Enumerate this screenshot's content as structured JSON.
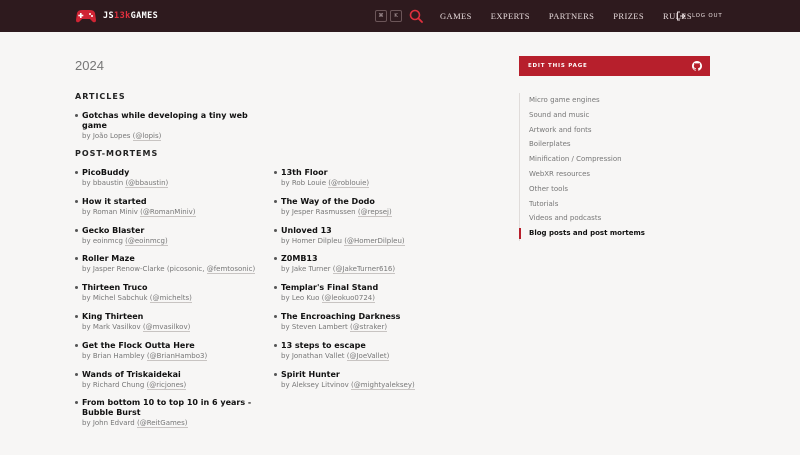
{
  "header": {
    "logo": {
      "part1": "JS",
      "part2": "13k",
      "part3": "GAMES"
    },
    "kbd": [
      "⌘",
      "K"
    ],
    "nav": [
      "Games",
      "Experts",
      "Partners",
      "Prizes",
      "Rules"
    ],
    "logout": "LOG OUT"
  },
  "page": {
    "year": "2024",
    "articles_heading": "ARTICLES",
    "postmortems_heading": "POST-MORTEMS"
  },
  "articles": [
    {
      "title": "Gotchas while developing a tiny web game",
      "author": "João Lopes",
      "handle": "(@lopis)"
    }
  ],
  "postmortems_left": [
    {
      "title": "PicoBuddy",
      "author": "bbaustin",
      "handle": "(@bbaustin)"
    },
    {
      "title": "How it started",
      "author": "Roman Miniv",
      "handle": "(@RomanMiniv)"
    },
    {
      "title": "Gecko Blaster",
      "author": "eoinmcg",
      "handle": "(@eoinmcg)"
    },
    {
      "title": "Roller Maze",
      "author": "Jasper Renow-Clarke (picosonic,",
      "handle": "@femtosonic)"
    },
    {
      "title": "Thirteen Truco",
      "author": "Michel Sabchuk",
      "handle": "(@michelts)"
    },
    {
      "title": "King Thirteen",
      "author": "Mark Vasilkov",
      "handle": "(@mvasilkov)"
    },
    {
      "title": "Get the Flock Outta Here",
      "author": "Brian Hambley",
      "handle": "(@BrianHambo3)"
    },
    {
      "title": "Wands of Triskaidekai",
      "author": "Richard Chung",
      "handle": "(@ricjones)"
    },
    {
      "title": "From bottom 10 to top 10 in 6 years - Bubble Burst",
      "author": "John Edvard",
      "handle": "(@ReitGames)"
    }
  ],
  "postmortems_right": [
    {
      "title": "13th Floor",
      "author": "Rob Louie",
      "handle": "(@roblouie)"
    },
    {
      "title": "The Way of the Dodo",
      "author": "Jesper Rasmussen",
      "handle": "(@repsej)"
    },
    {
      "title": "Unloved 13",
      "author": "Homer Dilpleu",
      "handle": "(@HomerDilpleu)"
    },
    {
      "title": "Z0MB13",
      "author": "Jake Turner",
      "handle": "(@JakeTurner616)"
    },
    {
      "title": "Templar's Final Stand",
      "author": "Leo Kuo",
      "handle": "(@leokuo0724)"
    },
    {
      "title": "The Encroaching Darkness",
      "author": "Steven Lambert",
      "handle": "(@straker)"
    },
    {
      "title": "13 steps to escape",
      "author": "Jonathan Vallet",
      "handle": "(@JoeVallet)"
    },
    {
      "title": "Spirit Hunter",
      "author": "Aleksey Litvinov",
      "handle": "(@mightyaleksey)"
    }
  ],
  "sidebar": {
    "edit_label": "EDIT THIS PAGE",
    "items": [
      "Micro game engines",
      "Sound and music",
      "Artwork and fonts",
      "Boilerplates",
      "Minification / Compression",
      "WebXR resources",
      "Other tools",
      "Tutorials",
      "Videos and podcasts",
      "Blog posts and post mortems"
    ],
    "active_index": 9
  },
  "colors": {
    "header_bg": "#2e1a1e",
    "accent": "#b71f2c",
    "page_bg": "#f7f6f5"
  }
}
